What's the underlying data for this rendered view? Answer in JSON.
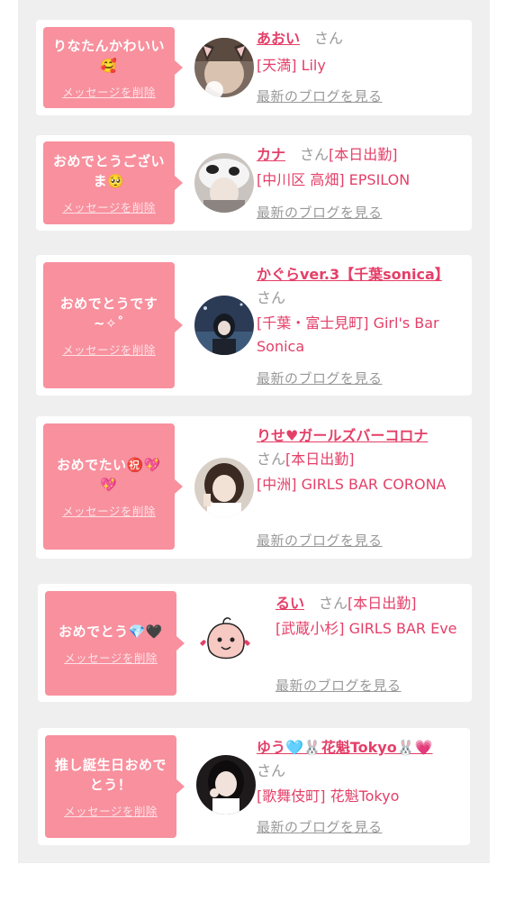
{
  "delete_label": "メッセージを削除",
  "blog_label": "最新のブログを見る",
  "san": "さん",
  "items": [
    {
      "message": "りなたんかわいい🥰",
      "name": "あおい",
      "status": "",
      "shop": "[天満] Lily",
      "avatar_icon": "cat-ear-avatar"
    },
    {
      "message": "おめでとうございま🥺",
      "name": "カナ",
      "status": "[本日出勤]",
      "shop": "[中川区 高畑] EPSILON",
      "avatar_icon": "cow-hat-avatar"
    },
    {
      "message": "おめでとうです~✧˚",
      "name": "かぐらver.3【千葉sonica】",
      "status": "",
      "shop": "[千葉・富士見町] Girl's Bar Sonica",
      "avatar_icon": "night-photo-avatar"
    },
    {
      "message": "おめでたい㊗️💖💖",
      "name": "りせ♥ガールズバーコロナ",
      "status": "[本日出勤]",
      "shop": "[中洲] GIRLS BAR CORONA",
      "avatar_icon": "portrait-avatar"
    },
    {
      "message": "おめでとう💎🖤",
      "name": "るい",
      "status": "[本日出勤]",
      "shop": "[武蔵小杉] GIRLS BAR Eve",
      "avatar_icon": "peach-character-avatar"
    },
    {
      "message": "推し誕生日おめでとう！",
      "name": "ゆう🩵🐰花魁Tokyo🐰💗",
      "status": "",
      "shop": "[歌舞伎町] 花魁Tokyo",
      "avatar_icon": "portrait-avatar-dark"
    }
  ]
}
